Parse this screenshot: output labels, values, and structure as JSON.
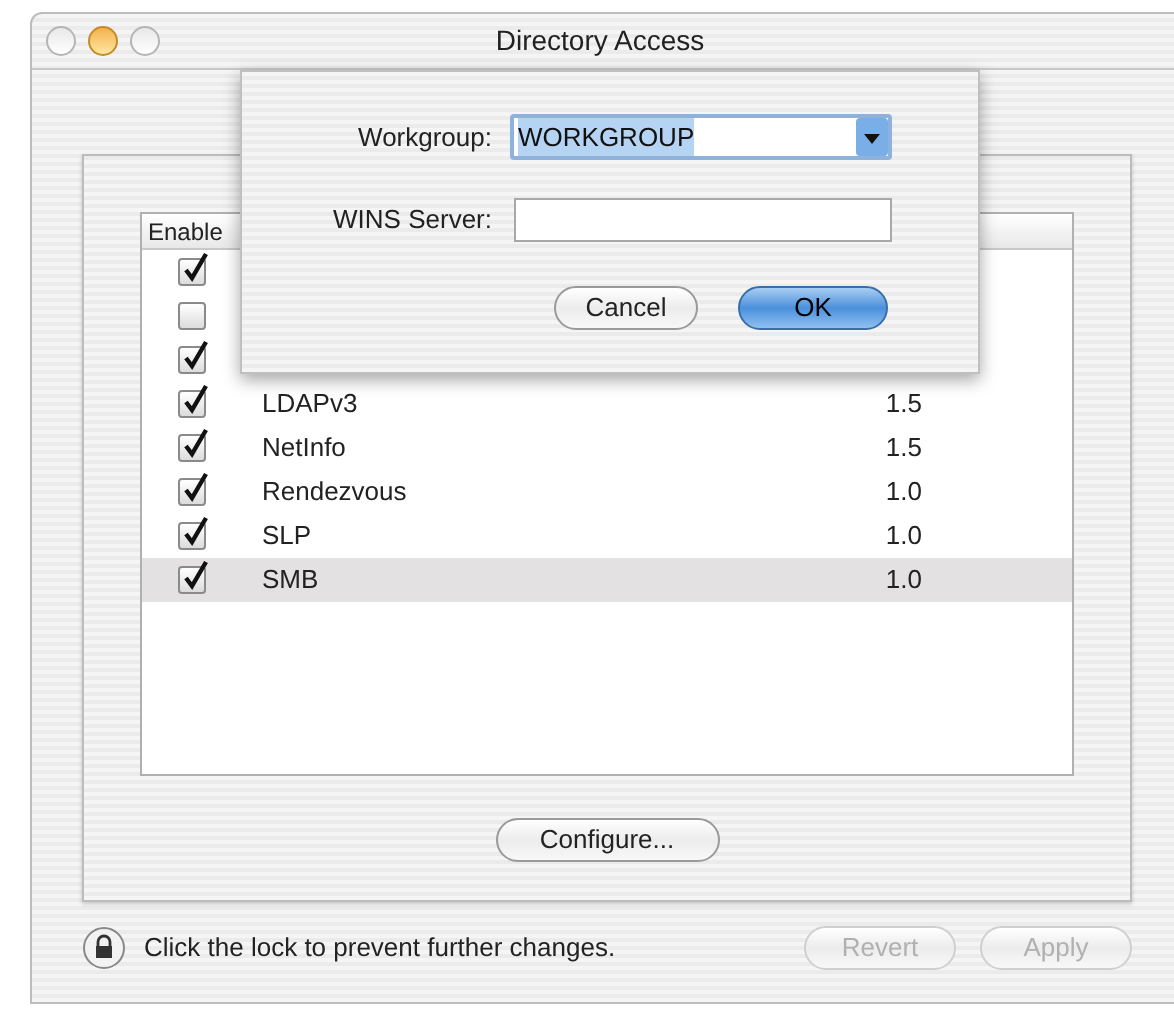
{
  "window": {
    "title": "Directory Access"
  },
  "table": {
    "columns": [
      "Enable"
    ],
    "rows": [
      {
        "checked": true,
        "selected": false
      },
      {
        "checked": false,
        "selected": false
      },
      {
        "checked": true,
        "selected": false
      },
      {
        "name": "LDAPv3",
        "version": "1.5",
        "checked": true,
        "selected": false
      },
      {
        "name": "NetInfo",
        "version": "1.5",
        "checked": true,
        "selected": false
      },
      {
        "name": "Rendezvous",
        "version": "1.0",
        "checked": true,
        "selected": false
      },
      {
        "name": "SLP",
        "version": "1.0",
        "checked": true,
        "selected": false
      },
      {
        "name": "SMB",
        "version": "1.0",
        "checked": true,
        "selected": true
      }
    ]
  },
  "configure_button": "Configure...",
  "lock": {
    "text": "Click the lock to prevent further changes."
  },
  "footer_buttons": [
    {
      "label": "Revert",
      "disabled": true
    },
    {
      "label": "Apply",
      "disabled": true
    }
  ],
  "sheet": {
    "workgroup": {
      "label": "Workgroup:",
      "value": "WORKGROUP",
      "text_selected": true
    },
    "wins": {
      "label": "WINS Server:"
    },
    "buttons": [
      {
        "label": "Cancel",
        "default": false
      },
      {
        "label": "OK",
        "default": true
      }
    ]
  }
}
